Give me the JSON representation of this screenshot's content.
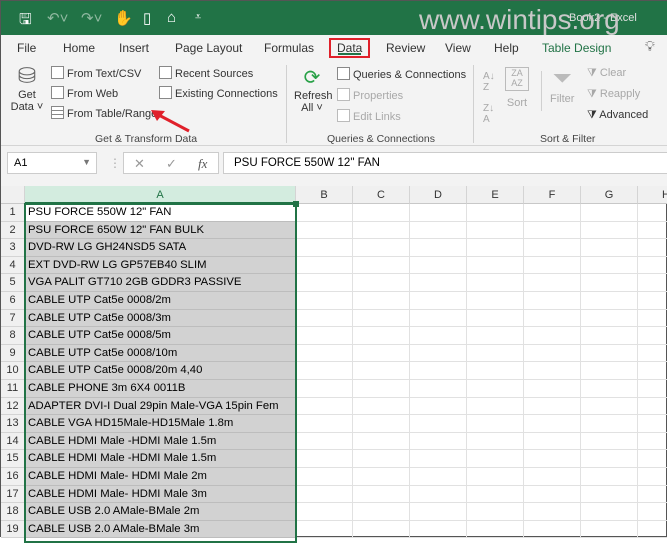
{
  "titlebar": {
    "watermark": "www.wintips.org",
    "doc_title": "Book2 - Excel",
    "icons": [
      "save-icon",
      "undo-icon",
      "redo-icon",
      "touch-mode-icon",
      "new-file-icon",
      "open-folder-icon",
      "customize-qat-icon"
    ]
  },
  "tabs": [
    "File",
    "Home",
    "Insert",
    "Page Layout",
    "Formulas",
    "Data",
    "Review",
    "View",
    "Help",
    "Table Design"
  ],
  "active_tab": "Data",
  "ribbon": {
    "get_data": "Get",
    "get_data2": "Data",
    "from_text_csv": "From Text/CSV",
    "from_web": "From Web",
    "from_table_range": "From Table/Range",
    "recent_sources": "Recent Sources",
    "existing_connections": "Existing Connections",
    "group_get_transform": "Get & Transform Data",
    "refresh": "Refresh",
    "refresh_all": "All",
    "queries_connections": "Queries & Connections",
    "properties": "Properties",
    "edit_links": "Edit Links",
    "group_queries": "Queries & Connections",
    "sort": "Sort",
    "filter": "Filter",
    "clear": "Clear",
    "reapply": "Reapply",
    "advanced": "Advanced",
    "group_sort_filter": "Sort & Filter"
  },
  "formula_bar": {
    "name_box": "A1",
    "fx": "fx",
    "value": "PSU FORCE 550W 12\" FAN"
  },
  "columns": [
    "A",
    "B",
    "C",
    "D",
    "E",
    "F",
    "G",
    "H"
  ],
  "rows": [
    {
      "n": "1",
      "a": "PSU FORCE 550W 12\" FAN"
    },
    {
      "n": "2",
      "a": "PSU FORCE 650W 12\" FAN BULK"
    },
    {
      "n": "3",
      "a": "DVD-RW LG GH24NSD5 SATA"
    },
    {
      "n": "4",
      "a": "EXT DVD-RW LG GP57EB40 SLIM"
    },
    {
      "n": "5",
      "a": "VGA PALIT GT710 2GB GDDR3 PASSIVE"
    },
    {
      "n": "6",
      "a": "CABLE UTP Cat5e 0008/2m"
    },
    {
      "n": "7",
      "a": "CABLE UTP Cat5e 0008/3m"
    },
    {
      "n": "8",
      "a": "CABLE UTP Cat5e 0008/5m"
    },
    {
      "n": "9",
      "a": "CABLE UTP Cat5e 0008/10m"
    },
    {
      "n": "10",
      "a": "CABLE UTP Cat5e 0008/20m 4,40"
    },
    {
      "n": "11",
      "a": "CABLE PHONE 3m 6X4 0011B"
    },
    {
      "n": "12",
      "a": "ADAPTER DVI-I Dual 29pin Male-VGA 15pin Fem"
    },
    {
      "n": "13",
      "a": "CABLE VGA HD15Male-HD15Male 1.8m"
    },
    {
      "n": "14",
      "a": "CABLE HDMI Male -HDMI Male 1.5m"
    },
    {
      "n": "15",
      "a": "CABLE HDMI Male -HDMI Male 1.5m"
    },
    {
      "n": "16",
      "a": "CABLE HDMI Male- HDMI Male 2m"
    },
    {
      "n": "17",
      "a": "CABLE HDMI Male- HDMI Male 3m"
    },
    {
      "n": "18",
      "a": "CABLE USB 2.0 AMale-BMale 2m"
    },
    {
      "n": "19",
      "a": "CABLE USB 2.0 AMale-BMale 3m"
    }
  ]
}
